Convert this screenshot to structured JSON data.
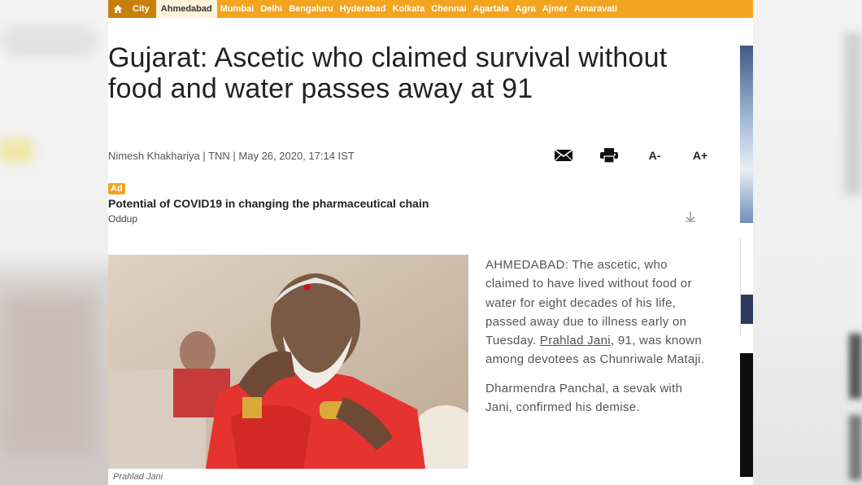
{
  "nav": {
    "home_icon": "home-icon",
    "city_label": "City",
    "active_city": "Ahmedabad",
    "cities": [
      "Mumbai",
      "Delhi",
      "Bengaluru",
      "Hyderabad",
      "Kolkata",
      "Chennai",
      "Agartala",
      "Agra",
      "Ajmer",
      "Amaravati"
    ],
    "accent": "#f3a51f"
  },
  "article": {
    "headline": "Gujarat: Ascetic who claimed survival without food and water passes away at 91",
    "byline": "Nimesh Khakhariya | TNN | May 26, 2020, 17:14 IST",
    "tools": {
      "email_icon": "email-icon",
      "print_icon": "print-icon",
      "font_decrease": "A-",
      "font_increase": "A+"
    },
    "ad": {
      "badge": "Ad",
      "title": "Potential of COVID19 in changing the pharmaceutical chain",
      "source": "Oddup"
    },
    "photo_caption": "Prahlad Jani",
    "paragraphs": [
      {
        "before": "AHMEDABAD: The ascetic, who claimed to have lived without food or water for eight decades of his life, passed away due to illness early on Tuesday. ",
        "link": "Prahlad Jani",
        "after": ", 91, was known among devotees as Chunriwale Mataji."
      },
      {
        "text": "Dharmendra Panchal, a sevak with Jani, confirmed his demise."
      }
    ]
  }
}
